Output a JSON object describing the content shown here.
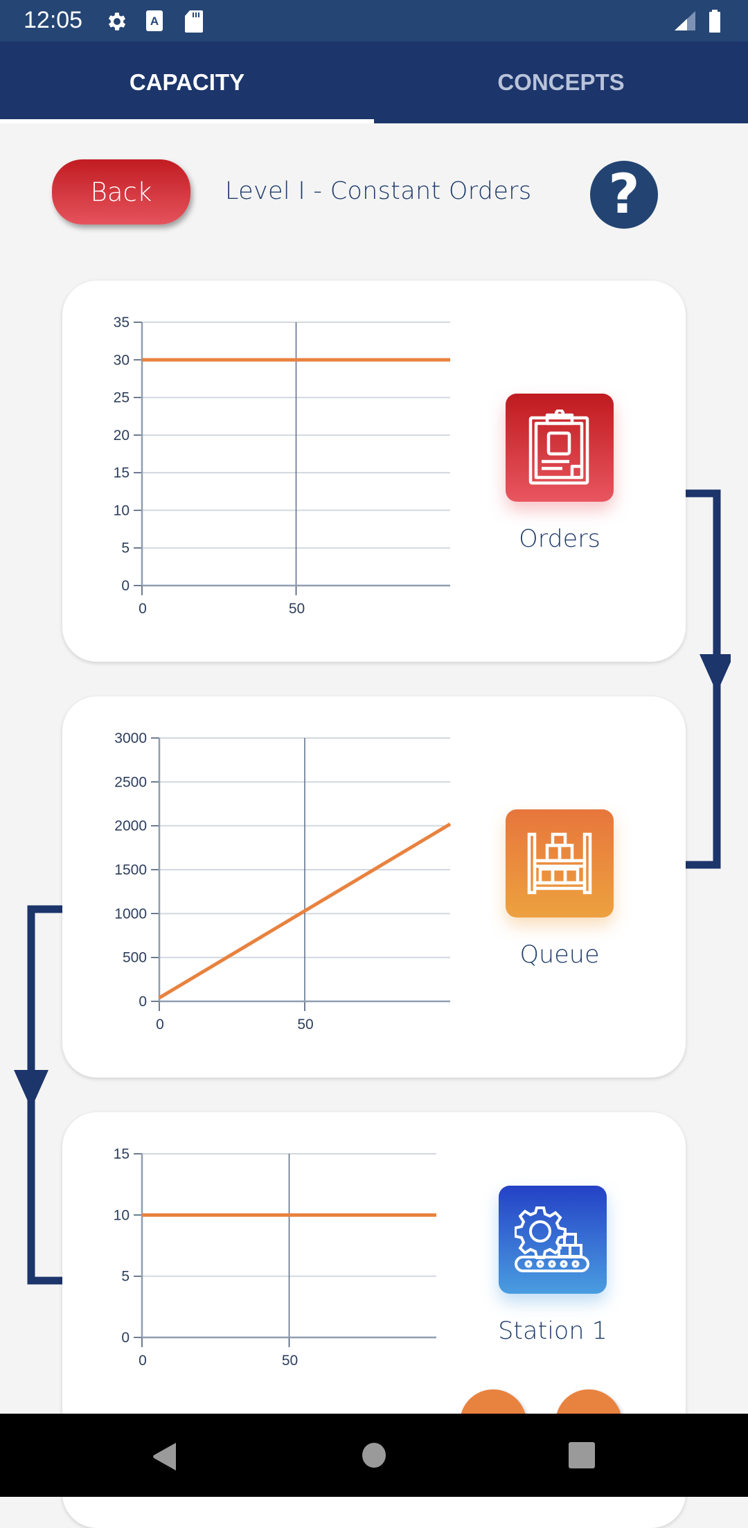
{
  "status_bar": {
    "time": "12:05",
    "icons": [
      "settings-icon",
      "a11y-card-icon",
      "sd-card-icon",
      "signal-icon",
      "battery-icon"
    ]
  },
  "tabs": [
    {
      "label": "CAPACITY",
      "active": true
    },
    {
      "label": "CONCEPTS",
      "active": false
    }
  ],
  "header": {
    "back_label": "Back",
    "title": "Level I - Constant Orders",
    "help_symbol": "?"
  },
  "colors": {
    "primary": "#1c356b",
    "accent_red": "#d63a42",
    "series": "#e8823f",
    "text": "#1e3b6b"
  },
  "nodes": [
    {
      "label": "Orders",
      "icon": "clipboard-icon"
    },
    {
      "label": "Queue",
      "icon": "shelf-boxes-icon"
    },
    {
      "label": "Station 1",
      "icon": "gear-conveyor-icon"
    }
  ],
  "chart_data": [
    {
      "type": "line",
      "title": "Orders",
      "xlabel": "",
      "ylabel": "",
      "x_ticks": [
        0,
        50
      ],
      "y_ticks": [
        0,
        5,
        10,
        15,
        20,
        25,
        30,
        35
      ],
      "xlim": [
        0,
        100
      ],
      "ylim": [
        0,
        35
      ],
      "grid": true,
      "series": [
        {
          "name": "Orders",
          "x": [
            0,
            100
          ],
          "values": [
            30,
            30
          ]
        }
      ]
    },
    {
      "type": "line",
      "title": "Queue",
      "xlabel": "",
      "ylabel": "",
      "x_ticks": [
        0,
        50
      ],
      "y_ticks": [
        0,
        500,
        1000,
        1500,
        2000,
        2500,
        3000
      ],
      "xlim": [
        0,
        100
      ],
      "ylim": [
        0,
        3000
      ],
      "grid": true,
      "series": [
        {
          "name": "Queue",
          "x": [
            0,
            100
          ],
          "values": [
            40,
            2020
          ]
        }
      ]
    },
    {
      "type": "line",
      "title": "Station 1",
      "xlabel": "",
      "ylabel": "",
      "x_ticks": [
        0,
        50
      ],
      "y_ticks": [
        0,
        5,
        10,
        15
      ],
      "xlim": [
        0,
        100
      ],
      "ylim": [
        0,
        15
      ],
      "grid": true,
      "series": [
        {
          "name": "Station 1",
          "x": [
            0,
            100
          ],
          "values": [
            10,
            10
          ]
        }
      ]
    }
  ],
  "nav": [
    "back",
    "home",
    "recents"
  ]
}
